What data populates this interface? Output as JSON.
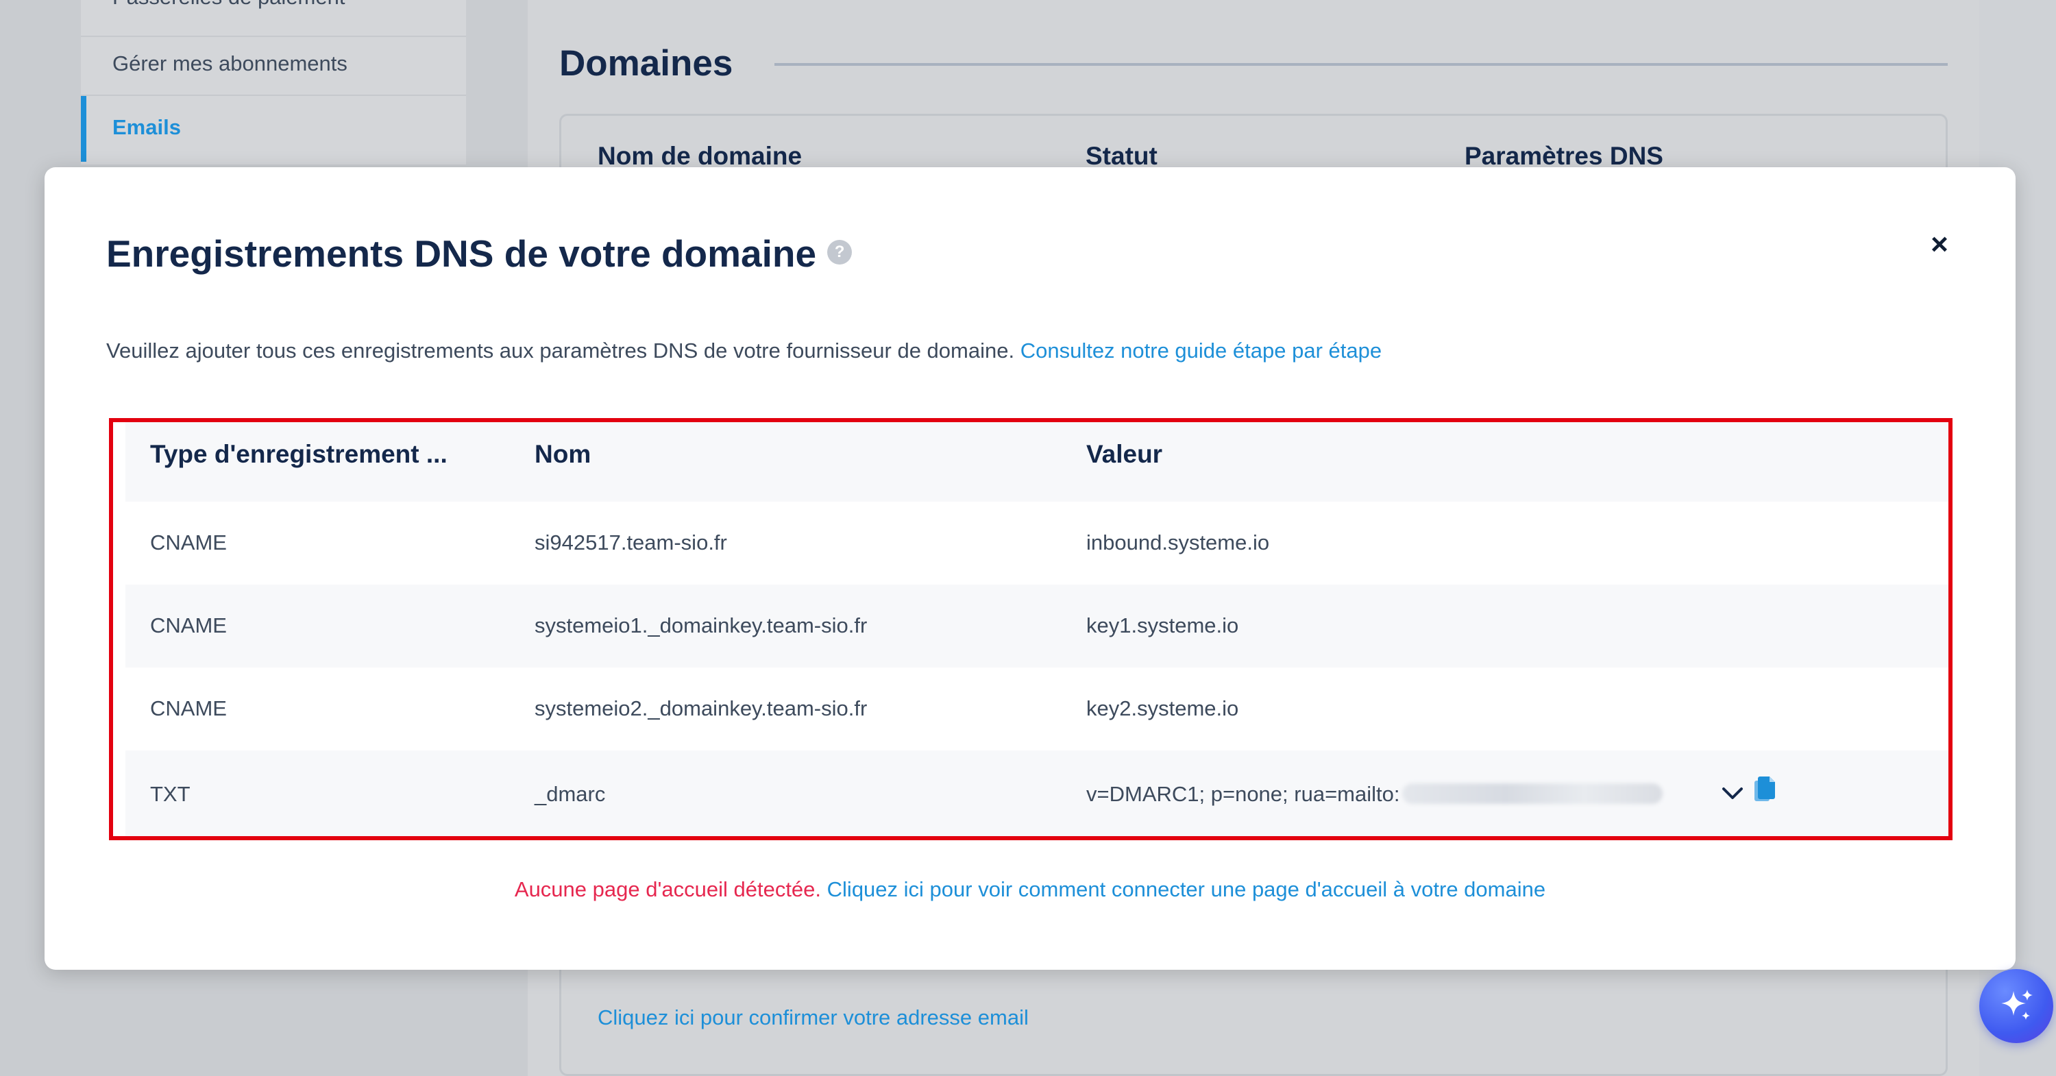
{
  "sidebar": {
    "items": [
      {
        "label": "Passerelles de paiement"
      },
      {
        "label": "Gérer mes abonnements"
      },
      {
        "label": "Emails"
      }
    ]
  },
  "main": {
    "title": "Domaines",
    "table_headers": [
      "Nom de domaine",
      "Statut",
      "Paramètres DNS"
    ],
    "confirm_link": "Cliquez ici pour confirmer votre adresse email"
  },
  "modal": {
    "title": "Enregistrements DNS de votre domaine",
    "help_icon": "?",
    "close_icon": "×",
    "intro_text": "Veuillez ajouter tous ces enregistrements aux paramètres DNS de votre fournisseur de domaine.",
    "intro_link": "Consultez notre guide étape par étape",
    "table": {
      "headers": [
        "Type d'enregistrement ...",
        "Nom",
        "Valeur"
      ],
      "rows": [
        {
          "type": "CNAME",
          "name": "si942517.team-sio.fr",
          "value": "inbound.systeme.io"
        },
        {
          "type": "CNAME",
          "name": "systemeio1._domainkey.team-sio.fr",
          "value": "key1.systeme.io"
        },
        {
          "type": "CNAME",
          "name": "systemeio2._domainkey.team-sio.fr",
          "value": "key2.systeme.io"
        },
        {
          "type": "TXT",
          "name": "_dmarc",
          "value": "v=DMARC1; p=none; rua=mailto:"
        }
      ]
    },
    "footer_warning": "Aucune page d'accueil détectée.",
    "footer_link": "Cliquez ici pour voir comment connecter une page d'accueil à votre domaine"
  },
  "colors": {
    "accent": "#1d8fd8",
    "title": "#14284b",
    "warning": "#e6274f",
    "highlight_border": "#e3000f"
  },
  "icons": [
    "help-icon",
    "close-icon",
    "chevron-down-icon",
    "copy-icon",
    "sparkle-icon"
  ]
}
